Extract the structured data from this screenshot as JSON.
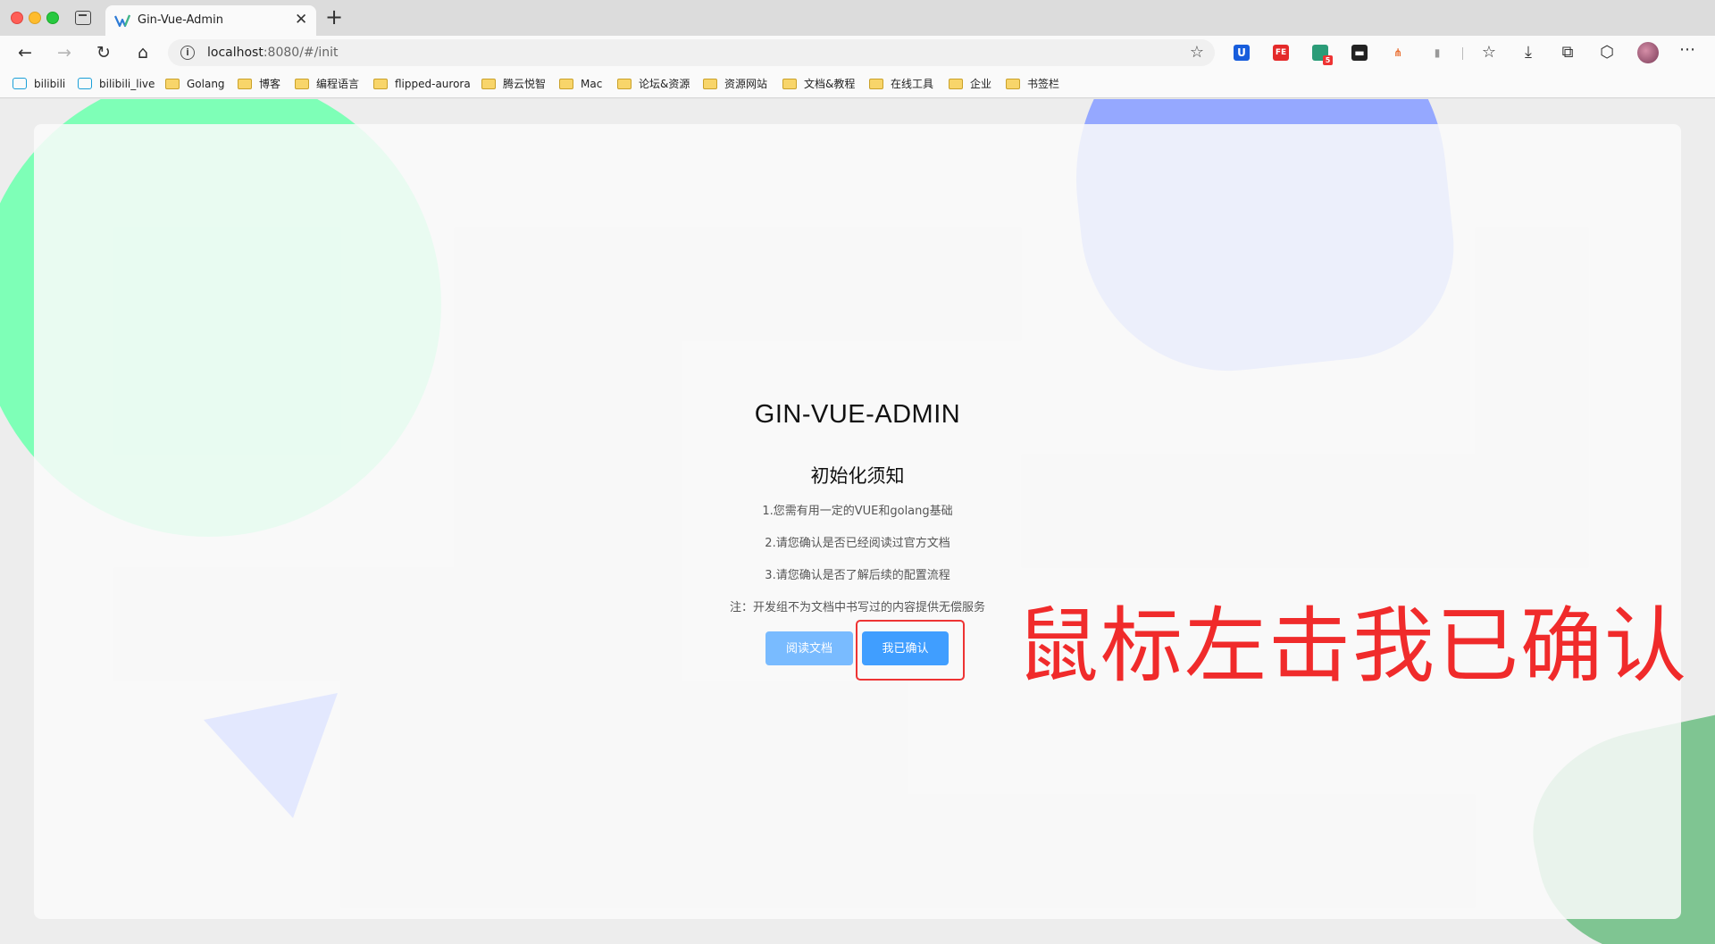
{
  "window": {
    "tab_title": "Gin-Vue-Admin"
  },
  "address_bar": {
    "host": "localhost",
    "path": ":8080/#/init"
  },
  "bookmarks": [
    {
      "label": "bilibili",
      "icon": "tv-icon"
    },
    {
      "label": "bilibili_live",
      "icon": "tv-icon"
    },
    {
      "label": "Golang",
      "icon": "folder-icon"
    },
    {
      "label": "博客",
      "icon": "folder-icon"
    },
    {
      "label": "编程语言",
      "icon": "folder-icon"
    },
    {
      "label": "flipped-aurora",
      "icon": "folder-icon"
    },
    {
      "label": "腾云悦智",
      "icon": "folder-icon"
    },
    {
      "label": "Mac",
      "icon": "folder-icon"
    },
    {
      "label": "论坛&资源",
      "icon": "folder-icon"
    },
    {
      "label": "资源网站",
      "icon": "folder-icon"
    },
    {
      "label": "文档&教程",
      "icon": "folder-icon"
    },
    {
      "label": "在线工具",
      "icon": "folder-icon"
    },
    {
      "label": "企业",
      "icon": "folder-icon"
    },
    {
      "label": "书签栏",
      "icon": "folder-icon"
    }
  ],
  "extensions": {
    "badge_count": "5"
  },
  "page": {
    "title": "GIN-VUE-ADMIN",
    "notice_title": "初始化须知",
    "notice_lines": [
      "1.您需有用一定的VUE和golang基础",
      "2.请您确认是否已经阅读过官方文档",
      "3.请您确认是否了解后续的配置流程",
      "注：开发组不为文档中书写过的内容提供无偿服务"
    ],
    "read_docs_button": "阅读文档",
    "confirm_button": "我已确认"
  },
  "annotation": {
    "text": "鼠标左击我已确认",
    "color": "#f02b2b"
  },
  "colors": {
    "primary": "#409eff",
    "primary_light": "#79bbff"
  }
}
